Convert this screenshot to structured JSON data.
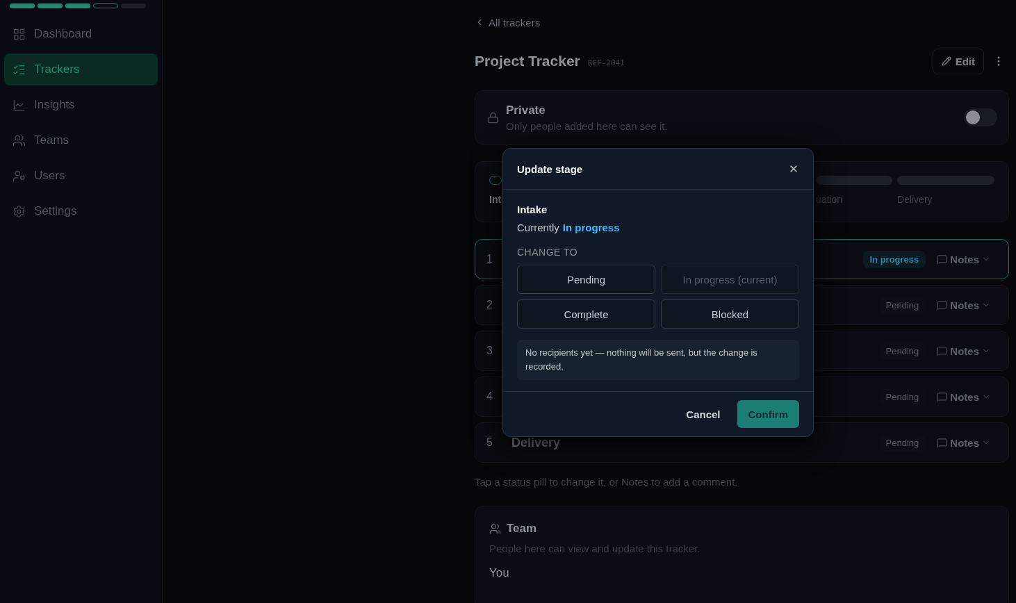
{
  "sidebar": {
    "progress": [
      {
        "kind": "done"
      },
      {
        "kind": "done"
      },
      {
        "kind": "done"
      },
      {
        "kind": "current"
      },
      {
        "kind": "todo"
      }
    ],
    "items": [
      {
        "label": "Dashboard",
        "selected": false
      },
      {
        "label": "Trackers",
        "selected": true
      },
      {
        "label": "Insights",
        "selected": false
      },
      {
        "label": "Teams",
        "selected": false
      },
      {
        "label": "Users",
        "selected": false
      },
      {
        "label": "Settings",
        "selected": false
      }
    ]
  },
  "main": {
    "back_link": "All trackers",
    "title": "Project Tracker",
    "ref": "REF-2041",
    "edit_button": "Edit",
    "privacy": {
      "title": "Private",
      "description": "Only people added here can see it.",
      "on": false
    },
    "stages": [
      {
        "label": "Int",
        "kind": "current"
      },
      {
        "label": "uation",
        "kind": "pending"
      },
      {
        "label": "Delivery",
        "kind": "pending"
      }
    ],
    "rows": [
      {
        "number": "1",
        "kind": "active",
        "status_label": "In progress",
        "notes": "Notes",
        "selected": true
      },
      {
        "number": "2",
        "kind": "pending",
        "status_label": "Pending",
        "notes": "Notes",
        "selected": false
      },
      {
        "number": "3",
        "kind": "pending",
        "status_label": "Pending",
        "notes": "Notes",
        "selected": false
      },
      {
        "number": "4",
        "kind": "pending",
        "status_label": "Pending",
        "notes": "Notes",
        "selected": false
      },
      {
        "number": "5",
        "title": "Delivery",
        "kind": "pending",
        "status_label": "Pending",
        "notes": "Notes",
        "selected": false
      }
    ],
    "hint": "Tap a status pill to change it, or Notes to add a comment.",
    "team": {
      "title": "Team",
      "description": "People here can view and update this tracker.",
      "members": [
        "You"
      ]
    }
  },
  "dialog": {
    "title": "Update stage",
    "stage": "Intake",
    "current_prefix": "Currently",
    "current_status": "In progress",
    "section_label": "CHANGE TO",
    "options": [
      {
        "label": "Pending",
        "disabled": false
      },
      {
        "label": "In progress (current)",
        "disabled": true
      },
      {
        "label": "Complete",
        "disabled": false
      },
      {
        "label": "Blocked",
        "disabled": false
      }
    ],
    "note": "No recipients yet — nothing will be sent, but the change is recorded.",
    "cancel": "Cancel",
    "confirm": "Confirm"
  }
}
